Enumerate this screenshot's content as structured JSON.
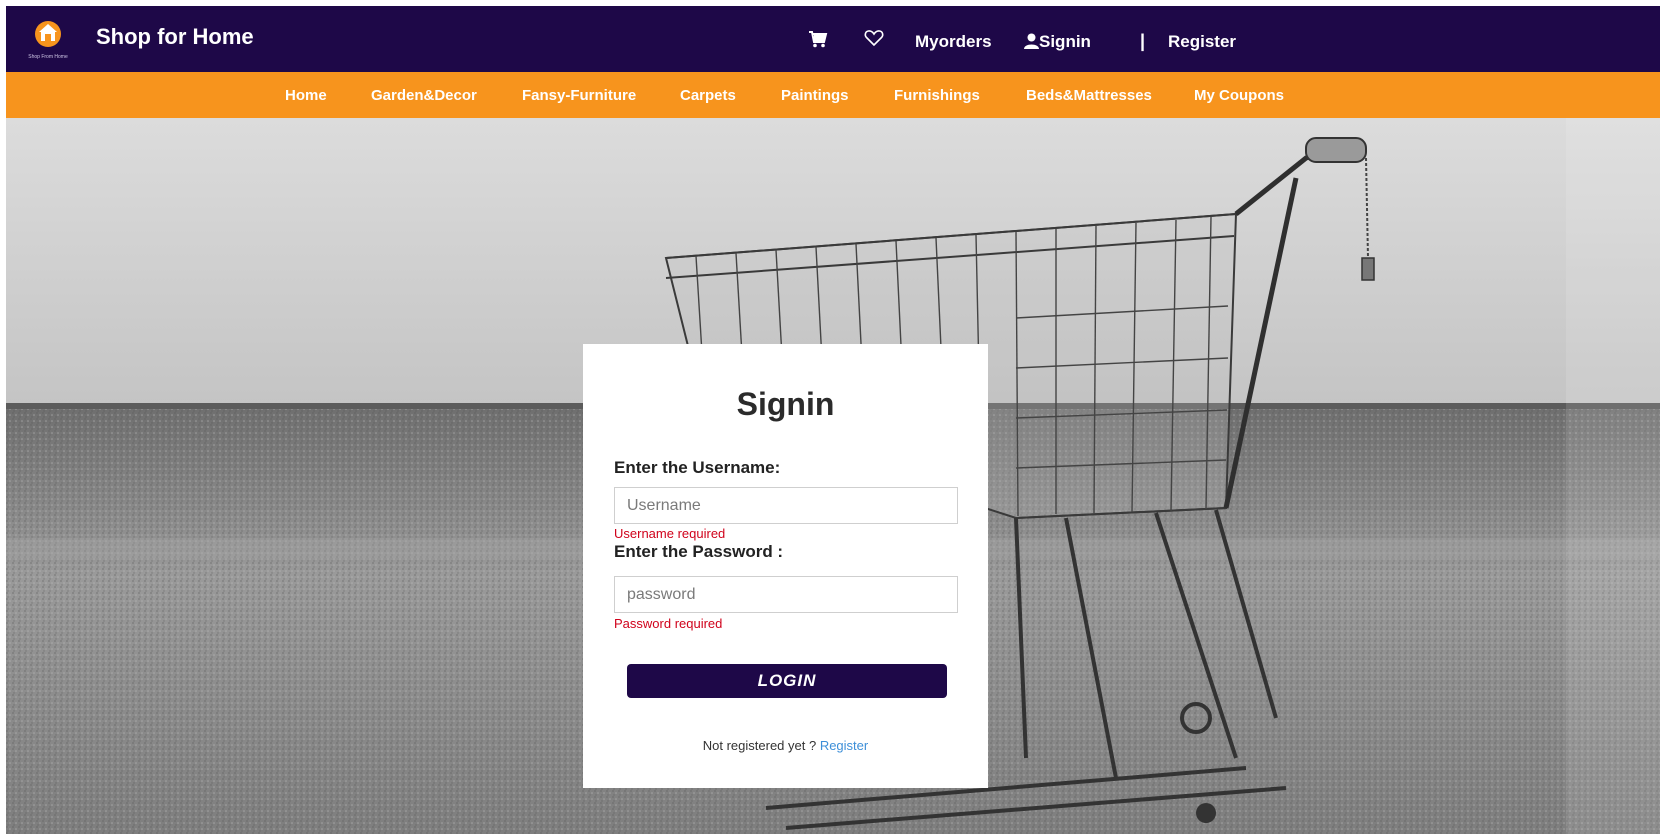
{
  "header": {
    "logo_caption": "Shop From Home",
    "brand": "Shop for Home",
    "icons": [
      "cart-icon",
      "heart-icon",
      "user-icon"
    ],
    "links": {
      "myorders": "Myorders",
      "signin": "Signin",
      "separator": "|",
      "register": "Register"
    }
  },
  "categories": [
    "Home",
    "Garden&Decor",
    "Fansy-Furniture",
    "Carpets",
    "Paintings",
    "Furnishings",
    "Beds&Mattresses",
    "My Coupons"
  ],
  "login_form": {
    "title": "Signin",
    "username_label": "Enter the Username:",
    "username_placeholder": "Username",
    "username_value": "",
    "username_error": "Username required",
    "password_label": "Enter the Password :",
    "password_placeholder": "password",
    "password_value": "",
    "password_error": "Password required",
    "login_button": "LOGIN",
    "not_registered_text": "Not registered yet ? ",
    "register_link": "Register"
  },
  "colors": {
    "header_bg": "#1e0848",
    "category_bar_bg": "#f7941d",
    "error_text": "#d0021b",
    "link": "#3d8fd8",
    "logo_accent": "#f7941d"
  }
}
